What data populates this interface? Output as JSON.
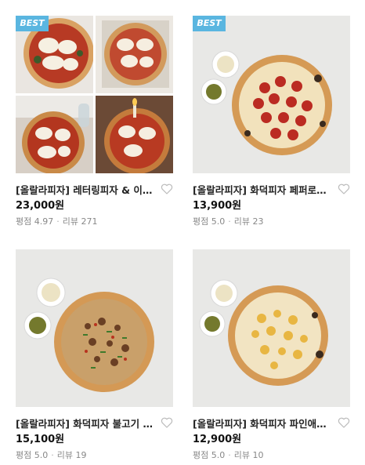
{
  "products": [
    {
      "badge": "BEST",
      "title": "[올랄라피자] 레터링피자 & 이벤트...",
      "price": "23,000원",
      "rating_label": "평점",
      "rating": "4.97",
      "review_label": "리뷰",
      "reviews": "271",
      "wish_icon": "heart-outline-icon"
    },
    {
      "badge": "BEST",
      "title": "[올랄라피자] 화덕피자 페퍼로니 프...",
      "price": "13,900원",
      "rating_label": "평점",
      "rating": "5.0",
      "review_label": "리뷰",
      "reviews": "23",
      "wish_icon": "heart-outline-icon"
    },
    {
      "badge": "",
      "title": "[올랄라피자] 화덕피자 불고기 프리...",
      "price": "15,100원",
      "rating_label": "평점",
      "rating": "5.0",
      "review_label": "리뷰",
      "reviews": "19",
      "wish_icon": "heart-outline-icon"
    },
    {
      "badge": "",
      "title": "[올랄라피자] 화덕피자 파인애플 고...",
      "price": "12,900원",
      "rating_label": "평점",
      "rating": "5.0",
      "review_label": "리뷰",
      "reviews": "10",
      "wish_icon": "heart-outline-icon"
    }
  ],
  "colors": {
    "badge": "#5ab6e0",
    "meta_text": "#888888",
    "heart_stroke": "#bbbbbb"
  }
}
